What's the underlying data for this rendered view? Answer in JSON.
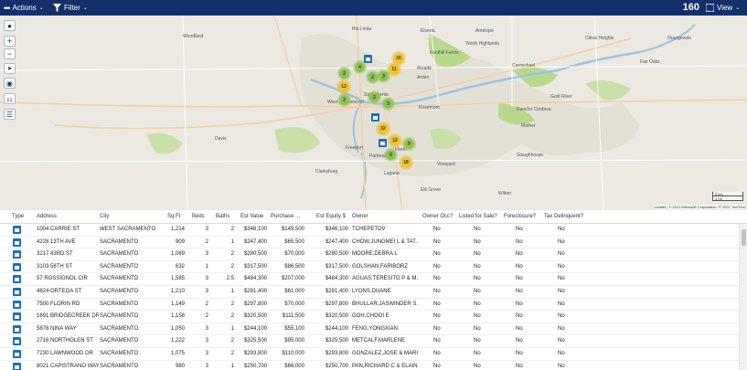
{
  "toolbar": {
    "actions_label": "Actions",
    "filter_label": "Filter",
    "result_count": "160",
    "view_label": "View",
    "bg_color": "#14306a"
  },
  "map": {
    "attribution": "Leaflet | © 2021 Microsoft Corporation, © 2021 TomTom",
    "scale_km": "5 km",
    "scale_mi": "3 mi",
    "tools": [
      "person-icon",
      "zoom-in-icon",
      "zoom-out-icon",
      "locate-arrow-icon",
      "globe-icon",
      "ruler-icon",
      "layers-icon"
    ],
    "place_labels": [
      "Rio Linda",
      "Elverta",
      "Antelope",
      "Citrus Heights",
      "Orangevale",
      "Foothill Farms",
      "North Highlands",
      "Carmichael",
      "Fair Oaks",
      "Arden",
      "Arcade",
      "Rancho Cordova",
      "Rosemont",
      "West Sacramento",
      "Sacramento",
      "Florin",
      "Parkway",
      "Elk Grove",
      "Vineyard",
      "Davis",
      "Clarksburg",
      "Sloughhouse",
      "Woodland",
      "Gold River",
      "Mather",
      "Freeport",
      "Laguna",
      "Wilton"
    ],
    "clusters": [
      {
        "label": "15",
        "color": "yellow"
      },
      {
        "label": "4",
        "color": "green"
      },
      {
        "label": "11",
        "color": "yellow"
      },
      {
        "label": "2",
        "color": "green"
      },
      {
        "label": "2",
        "color": "green"
      },
      {
        "label": "3",
        "color": "green"
      },
      {
        "label": "13",
        "color": "yellow"
      },
      {
        "label": "2",
        "color": "green"
      },
      {
        "label": "2",
        "color": "green"
      },
      {
        "label": "3",
        "color": "green"
      },
      {
        "label": "32",
        "color": "yellow"
      },
      {
        "label": "12",
        "color": "yellow"
      },
      {
        "label": "9",
        "color": "green"
      },
      {
        "label": "6",
        "color": "green"
      },
      {
        "label": "18",
        "color": "yellow"
      }
    ]
  },
  "columns": [
    "Type",
    "Address",
    "City",
    "Sq Ft",
    "Beds",
    "Baths",
    "Est Value",
    "Purchase ...",
    "Est Equity $",
    "Owner",
    "Owner Occ?",
    "Listed for Sale?",
    "Foreclosure?",
    "Tax Delinquent?"
  ],
  "rows": [
    {
      "address": "1004 CARRIE ST",
      "city": "WEST SACRAMENTO",
      "sqft": "1,214",
      "beds": "3",
      "baths": "2",
      "est_value": "$346,100",
      "purchase": "$149,500",
      "equity": "$346,100",
      "owner": "TCHEPETOV",
      "owner_occ": "No",
      "listed": "No",
      "foreclosure": "No",
      "tax": "No"
    },
    {
      "address": "4228 13TH AVE",
      "city": "SACRAMENTO",
      "sqft": "909",
      "beds": "2",
      "baths": "1",
      "est_value": "$247,400",
      "purchase": "$65,500",
      "equity": "$247,400",
      "owner": "CHOW,JUNGMEI L & TAT...",
      "owner_occ": "No",
      "listed": "No",
      "foreclosure": "No",
      "tax": "No"
    },
    {
      "address": "3217 43RD ST",
      "city": "SACRAMENTO",
      "sqft": "1,069",
      "beds": "3",
      "baths": "2",
      "est_value": "$280,500",
      "purchase": "$70,000",
      "equity": "$280,500",
      "owner": "MOORE,DEBRA L",
      "owner_occ": "No",
      "listed": "No",
      "foreclosure": "No",
      "tax": "No"
    },
    {
      "address": "3103 58TH ST",
      "city": "SACRAMENTO",
      "sqft": "632",
      "beds": "1",
      "baths": "2",
      "est_value": "$317,500",
      "purchase": "$86,500",
      "equity": "$317,500",
      "owner": "GOLSHAN,FARIBORZ",
      "owner_occ": "No",
      "listed": "No",
      "foreclosure": "No",
      "tax": "No"
    },
    {
      "address": "57 ROSSIGNOL CIR",
      "city": "SACRAMENTO",
      "sqft": "1,585",
      "beds": "3",
      "baths": "2.5",
      "est_value": "$484,300",
      "purchase": "$207,000",
      "equity": "$484,300",
      "owner": "AGUAS,TERESITO P & M...",
      "owner_occ": "No",
      "listed": "No",
      "foreclosure": "No",
      "tax": "No"
    },
    {
      "address": "4824 ORTEGA ST",
      "city": "SACRAMENTO",
      "sqft": "1,210",
      "beds": "3",
      "baths": "1",
      "est_value": "$281,400",
      "purchase": "$61,000",
      "equity": "$281,400",
      "owner": "LYONS,DUANE",
      "owner_occ": "No",
      "listed": "No",
      "foreclosure": "No",
      "tax": "No"
    },
    {
      "address": "7500 FLORIN RD",
      "city": "SACRAMENTO",
      "sqft": "1,149",
      "beds": "2",
      "baths": "2",
      "est_value": "$297,800",
      "purchase": "$70,000",
      "equity": "$297,800",
      "owner": "BHULLAR,JASWINDER S...",
      "owner_occ": "No",
      "listed": "No",
      "foreclosure": "No",
      "tax": "No"
    },
    {
      "address": "1691 BRIDGECREEK DR",
      "city": "SACRAMENTO",
      "sqft": "1,158",
      "beds": "2",
      "baths": "2",
      "est_value": "$320,500",
      "purchase": "$111,500",
      "equity": "$320,500",
      "owner": "GOH,CHOOI E",
      "owner_occ": "No",
      "listed": "No",
      "foreclosure": "No",
      "tax": "No"
    },
    {
      "address": "5878 NINA WAY",
      "city": "SACRAMENTO",
      "sqft": "1,050",
      "beds": "3",
      "baths": "1",
      "est_value": "$244,100",
      "purchase": "$55,100",
      "equity": "$244,100",
      "owner": "FENG,YONGXIAN",
      "owner_occ": "No",
      "listed": "No",
      "foreclosure": "No",
      "tax": "No"
    },
    {
      "address": "2716 NORTHGLEN ST",
      "city": "SACRAMENTO",
      "sqft": "1,222",
      "beds": "3",
      "baths": "2",
      "est_value": "$325,500",
      "purchase": "$95,000",
      "equity": "$325,500",
      "owner": "METCALF,MARLENE",
      "owner_occ": "No",
      "listed": "No",
      "foreclosure": "No",
      "tax": "No"
    },
    {
      "address": "7230 LAWNWOOD DR",
      "city": "SACRAMENTO",
      "sqft": "1,075",
      "beds": "3",
      "baths": "2",
      "est_value": "$293,800",
      "purchase": "$110,000",
      "equity": "$293,800",
      "owner": "GONZALEZ,JOSE & MARIA",
      "owner_occ": "No",
      "listed": "No",
      "foreclosure": "No",
      "tax": "No"
    },
    {
      "address": "8021 CAPISTRANO WAY",
      "city": "SACRAMENTO",
      "sqft": "980",
      "beds": "3",
      "baths": "1",
      "est_value": "$250,700",
      "purchase": "$66,000",
      "equity": "$250,700",
      "owner": "PAN,RICHARD C & ELAIN...",
      "owner_occ": "No",
      "listed": "No",
      "foreclosure": "No",
      "tax": "No"
    }
  ]
}
